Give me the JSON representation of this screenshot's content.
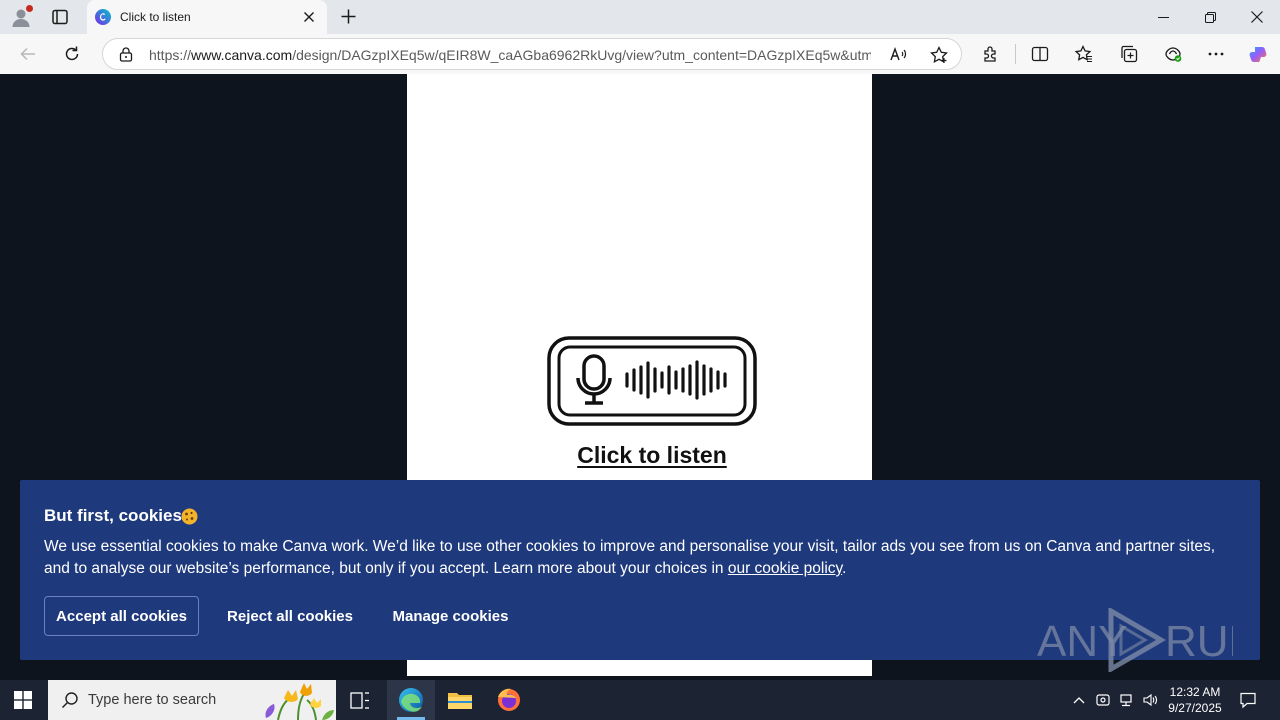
{
  "browser": {
    "tab_title": "Click to listen",
    "url_prefix": "https://",
    "url_domain": "www.canva.com",
    "url_rest": "/design/DAGzpIXEq5w/qEIR8W_caAGba6962RkUvg/view?utm_content=DAGzpIXEq5w&utm..."
  },
  "page": {
    "listen_link": "Click to listen"
  },
  "cookie_banner": {
    "title": "But first, cookies",
    "body": "We use essential cookies to make Canva work. We’d like to use other cookies to improve and personalise your visit, tailor ads you see from us on Canva and partner sites, and to analyse our website’s performance, but only if you accept. Learn more about your choices in ",
    "policy_link": "our cookie policy",
    "body_end": ".",
    "accept_label": "Accept all cookies",
    "reject_label": "Reject all cookies",
    "manage_label": "Manage cookies",
    "background_color": "#1f3a7c"
  },
  "watermark": {
    "left_text": "ANY",
    "right_text": "RUN"
  },
  "taskbar": {
    "search_placeholder": "Type here to search",
    "time": "12:32 AM",
    "date": "9/27/2025"
  }
}
